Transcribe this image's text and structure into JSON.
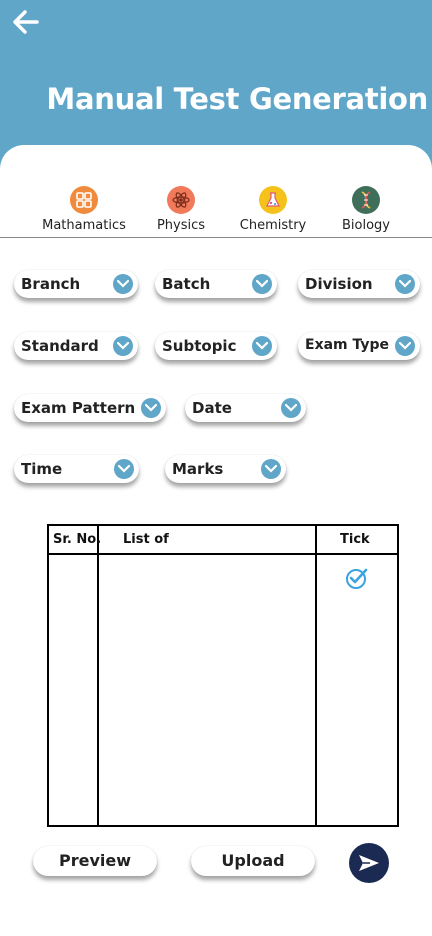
{
  "header": {
    "title": "Manual Test Generation",
    "back_icon": "arrow-left-icon",
    "bg_color": "#5fa6c9"
  },
  "subjects": [
    {
      "label": "Mathamatics",
      "icon": "calculator-icon",
      "color": "#f08a3c"
    },
    {
      "label": "Physics",
      "icon": "atom-icon",
      "color": "#f07a5a"
    },
    {
      "label": "Chemistry",
      "icon": "flask-icon",
      "color": "#f5c21b"
    },
    {
      "label": "Biology",
      "icon": "dna-icon",
      "color": "#3f6e5a"
    }
  ],
  "filters": {
    "branch": "Branch",
    "batch": "Batch",
    "division": "Division",
    "standard": "Standard",
    "subtopic": "Subtopic",
    "exam_type": "Exam Type",
    "exam_pattern": "Exam Pattern",
    "date": "Date",
    "time": "Time",
    "marks": "Marks"
  },
  "table": {
    "columns": [
      "Sr. No.",
      "List of",
      "Tick"
    ],
    "rows": [
      {
        "sr_no": "",
        "item": "",
        "ticked": true
      }
    ]
  },
  "actions": {
    "preview": "Preview",
    "upload": "Upload",
    "send_icon": "send-icon"
  }
}
